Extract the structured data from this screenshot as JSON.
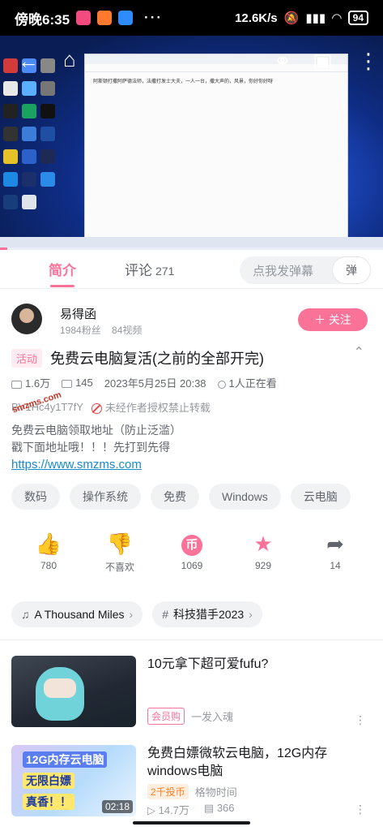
{
  "status_bar": {
    "time": "傍晚6:35",
    "net_speed": "12.6K/s",
    "battery": "94",
    "more": "···"
  },
  "player": {
    "window_text": "阿斯顿打撒阿萨德法师，法撒打发士大夫，一人一台，撒大声的，风景，你好你好呀",
    "progress_fraction": 0.02,
    "watermark": "smzms.com"
  },
  "tabs": {
    "intro": "简介",
    "comments_label": "评论",
    "comments_count": "271",
    "danmu_placeholder": "点我发弹幕",
    "danmu_icon": "弹"
  },
  "author": {
    "name": "易得函",
    "fans": "1984粉丝",
    "videos": "84视频",
    "follow_label": "＋ 关注"
  },
  "video": {
    "activity_badge": "活动",
    "title": "免费云电脑复活(之前的全部开完)",
    "views": "1.6万",
    "danmaku": "145",
    "date": "2023年5月25日 20:38",
    "watching": "1人正在看",
    "bvid": "BV1Hc4y1T7fY",
    "no_repost": "未经作者授权禁止转载",
    "desc_line1": "免费云电脑领取地址（防止泛滥）",
    "desc_line2": "戳下面地址哦！！！先打到先得",
    "desc_link": "https://www.smzms.com"
  },
  "tags": [
    "数码",
    "操作系统",
    "免费",
    "Windows",
    "云电脑"
  ],
  "actions": {
    "like": "780",
    "dislike": "不喜欢",
    "coin": "1069",
    "favorite": "929",
    "share": "14"
  },
  "chips": {
    "music": "A Thousand Miles",
    "event": "科技猎手2023"
  },
  "recommendations": [
    {
      "title": "10元拿下超可爱fufu?",
      "badge": "会员购",
      "uploader": "一发入魂"
    },
    {
      "title": "免费白嫖微软云电脑，12G内存windows电脑",
      "badge": "2千投币",
      "uploader": "格物时间",
      "views": "14.7万",
      "danmaku": "366",
      "duration": "02:18",
      "thumb_line1": "12G内存云电脑",
      "thumb_line2": "无限白嫖",
      "thumb_line3": "真香！！"
    }
  ],
  "colors": {
    "accent": "#fb7299",
    "link": "#178bcf",
    "text": "#18191c",
    "subtext": "#61666d"
  }
}
